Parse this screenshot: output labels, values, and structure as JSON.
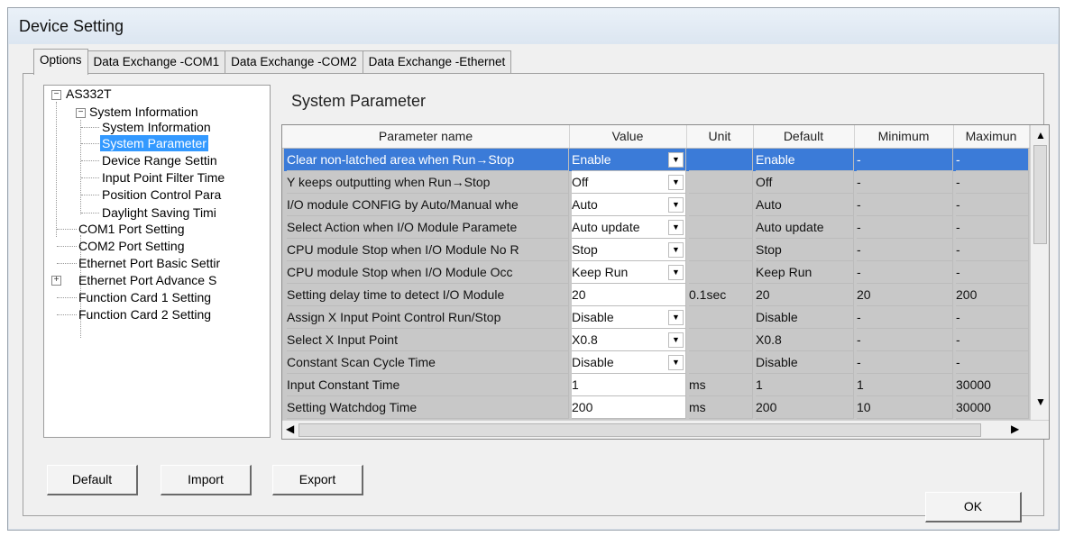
{
  "window": {
    "title": "Device Setting"
  },
  "tabs": [
    {
      "label": "Options"
    },
    {
      "label": "Data Exchange -COM1"
    },
    {
      "label": "Data Exchange -COM2"
    },
    {
      "label": "Data Exchange -Ethernet"
    }
  ],
  "tree": {
    "root": "AS332T",
    "system_information": "System Information",
    "children": [
      "System Information",
      "System Parameter",
      "Device Range Settin",
      "Input Point Filter Time",
      "Position Control Para",
      "Daylight Saving Timi"
    ],
    "com1": "COM1 Port Setting",
    "com2": "COM2 Port Setting",
    "eth_basic": "Ethernet Port Basic Settir",
    "eth_adv": "Ethernet Port Advance S",
    "fc1": "Function Card 1 Setting",
    "fc2": "Function Card 2 Setting"
  },
  "section_title": "System Parameter",
  "grid": {
    "headers": [
      "Parameter name",
      "Value",
      "Unit",
      "Default",
      "Minimum",
      "Maximun"
    ],
    "rows": [
      {
        "name": "Clear non-latched area when Run→Stop",
        "value": "Enable",
        "unit": "",
        "default": "Enable",
        "min": "-",
        "max": "-"
      },
      {
        "name": "Y keeps outputting when Run→Stop",
        "value": "Off",
        "unit": "",
        "default": "Off",
        "min": "-",
        "max": "-"
      },
      {
        "name": "I/O module CONFIG by Auto/Manual whe",
        "value": "Auto",
        "unit": "",
        "default": "Auto",
        "min": "-",
        "max": "-"
      },
      {
        "name": "Select Action when I/O Module Paramete",
        "value": "Auto update",
        "unit": "",
        "default": "Auto update",
        "min": "-",
        "max": "-"
      },
      {
        "name": "CPU module Stop when I/O Module No R",
        "value": "Stop",
        "unit": "",
        "default": "Stop",
        "min": "-",
        "max": "-"
      },
      {
        "name": "CPU module Stop when I/O Module Occ",
        "value": "Keep Run",
        "unit": "",
        "default": "Keep Run",
        "min": "-",
        "max": "-"
      },
      {
        "name": "Setting delay time to detect I/O Module",
        "value": "20",
        "unit": "0.1sec",
        "default": "20",
        "min": "20",
        "max": "200"
      },
      {
        "name": "Assign X Input Point Control Run/Stop",
        "value": "Disable",
        "unit": "",
        "default": "Disable",
        "min": "-",
        "max": "-"
      },
      {
        "name": "Select X Input Point",
        "value": "X0.8",
        "unit": "",
        "default": "X0.8",
        "min": "-",
        "max": "-"
      },
      {
        "name": "Constant Scan Cycle Time",
        "value": "Disable",
        "unit": "",
        "default": "Disable",
        "min": "-",
        "max": "-"
      },
      {
        "name": "Input Constant Time",
        "value": "1",
        "unit": "ms",
        "default": "1",
        "min": "1",
        "max": "30000"
      },
      {
        "name": "Setting Watchdog Time",
        "value": "200",
        "unit": "ms",
        "default": "200",
        "min": "10",
        "max": "30000"
      }
    ]
  },
  "buttons": {
    "default": "Default",
    "import": "Import",
    "export": "Export",
    "ok": "OK"
  },
  "colors": {
    "selection": "#3b7bd8",
    "tree_selection": "#3399ff"
  }
}
